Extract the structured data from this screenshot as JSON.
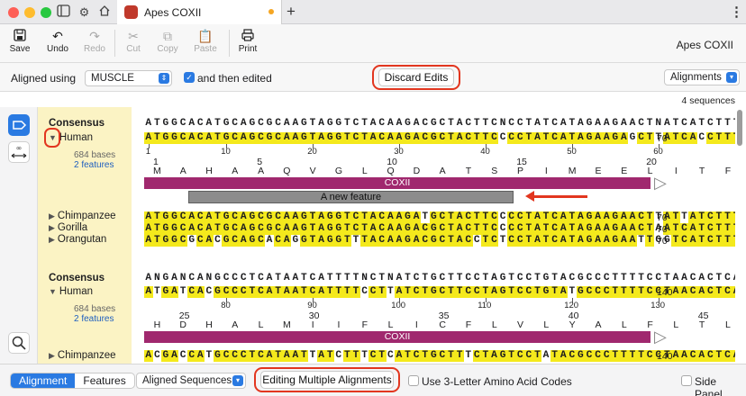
{
  "window": {
    "tab_title": "Apes COXII",
    "new_tab": "+",
    "more": "⋮"
  },
  "toolbar": {
    "save": "Save",
    "undo": "Undo",
    "redo": "Redo",
    "cut": "Cut",
    "copy": "Copy",
    "paste": "Paste",
    "print": "Print",
    "doc_title": "Apes COXII"
  },
  "options": {
    "aligned_using_label": "Aligned using",
    "aligner": "MUSCLE",
    "and_then_edited": "and then edited",
    "and_then_edited_checked": true,
    "discard_edits": "Discard Edits",
    "view_select": "Alignments"
  },
  "sequence_count": "4 sequences",
  "names": {
    "consensus": "Consensus",
    "human": "Human",
    "human_bases": "684 bases",
    "human_features": "2 features",
    "chimpanzee": "Chimpanzee",
    "gorilla": "Gorilla",
    "orangutan": "Orangutan"
  },
  "block1": {
    "consensus": "ATGGCACATGCAGCGCAAGTAGGTCTACAAGACGCTACTTCNCCTATCATAGAAGAACTNATCATCTTTC",
    "human": "ATGGCACATGCAGCGCAAGTAGGTCTACAAGACGCTACTTCCCCTATCATAGAAGAGCTTATCACCTTTC",
    "chimpanzee": "ATGGCACATGCAGCGCAAGTAGGTCTACAAGATGCTACTTCCCCTATCATAGAAGAACTTATTATCTTTC",
    "gorilla": "ATGGCACATGCAGCGCAAGTAGGTCTACAAGACGCTACTTCCCCTATCATAGAAGAACTAATCATCTTTC",
    "orangutan": "ATGGCGCACGCAGCACAGGTAGGTTTACAAGACGCTACCTCTCCTATCATAGAAGAATTGGTCATCTTTC",
    "row_end": "70",
    "ruler": [
      "1",
      "10",
      "20",
      "30",
      "40",
      "50",
      "60",
      "70"
    ],
    "aa_numbers": [
      "1",
      "5",
      "10",
      "15",
      "20"
    ],
    "aa": [
      "M",
      "A",
      "H",
      "A",
      "A",
      "Q",
      "V",
      "G",
      "L",
      "Q",
      "D",
      "A",
      "T",
      "S",
      "P",
      "I",
      "M",
      "E",
      "E",
      "L",
      "I",
      "T",
      "F"
    ],
    "feature": "COXII",
    "new_feature": "A new feature"
  },
  "block2": {
    "consensus": "ANGANCANGCCCTCATAATCATTTTNCTNATCTGCTTCCTAGTCCTGTACGCCCTTTTCCTAACACTCAC",
    "human": "ATGATCACGCCCTCATAATCATTTTCCTTATCTGCTTCCTAGTCCTGTATGCCCTTTTCCTAACACTCAC",
    "chimpanzee": "ACGACCATGCCCTCATAATTATCTTTCTCATCTGCTTTCTAGTCCTATACGCCCTTTTCCTAACACTCAC",
    "row_end": "140",
    "ruler": [
      "80",
      "90",
      "100",
      "110",
      "120",
      "130",
      "140"
    ],
    "aa_numbers": [
      "25",
      "30",
      "35",
      "40",
      "45"
    ],
    "aa": [
      "H",
      "D",
      "H",
      "A",
      "L",
      "M",
      "I",
      "I",
      "F",
      "L",
      "I",
      "C",
      "F",
      "L",
      "V",
      "L",
      "Y",
      "A",
      "L",
      "F",
      "L",
      "T",
      "L"
    ],
    "human_bases": "684 bases",
    "human_features": "2 features",
    "feature": "COXII"
  },
  "bottom": {
    "tab_alignment": "Alignment",
    "tab_features": "Features",
    "sequences_select": "Aligned Sequences",
    "editing_multiple": "Editing Multiple Alignments",
    "three_letter": "Use 3-Letter Amino Acid Codes",
    "side_panel": "Side Panel"
  },
  "colors": {
    "highlight_ring": "#e2361f",
    "accent": "#2a7ae2",
    "feature_bar": "#a0286e",
    "match_yellow": "#f4e91c",
    "name_column": "#fbf3c4"
  }
}
